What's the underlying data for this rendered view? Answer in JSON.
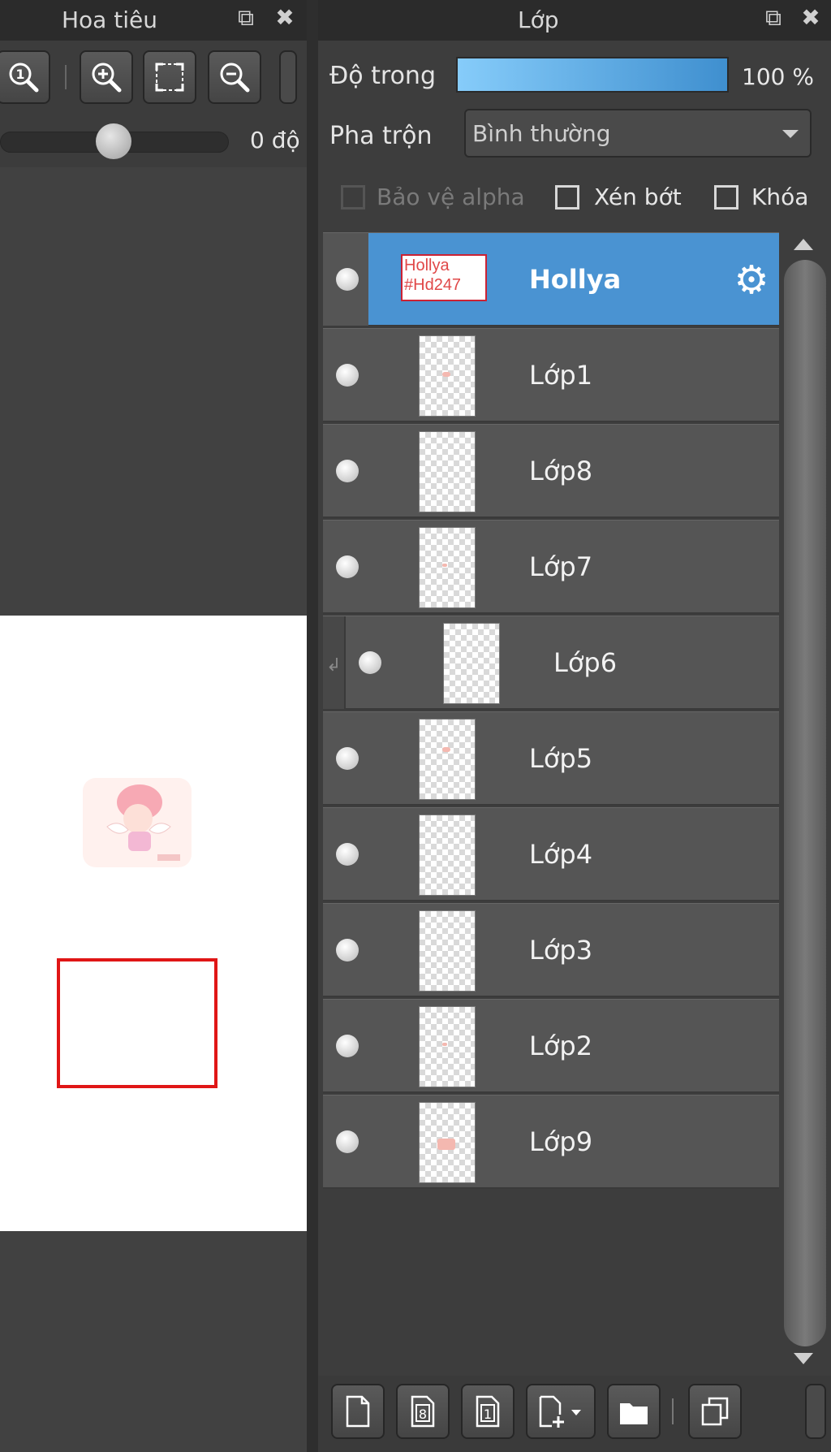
{
  "navigator": {
    "title": "Hoa tiêu",
    "rotation": {
      "value_label": "0 độ",
      "value": 0
    }
  },
  "layers_panel": {
    "title": "Lớp",
    "opacity": {
      "label": "Độ trong",
      "value_label": "100 %",
      "value": 100
    },
    "blend": {
      "label": "Pha trộn",
      "value": "Bình thường"
    },
    "checkboxes": [
      {
        "label": "Bảo vệ alpha",
        "checked": false,
        "enabled": false
      },
      {
        "label": "Xén bớt",
        "checked": false,
        "enabled": true
      },
      {
        "label": "Khóa",
        "checked": false,
        "enabled": true
      }
    ],
    "layers": [
      {
        "name": "Hollya",
        "selected": true,
        "thumbnail_text": "Hollya #Hd247",
        "clipped": false
      },
      {
        "name": "Lớp1",
        "selected": false,
        "clipped": false
      },
      {
        "name": "Lớp8",
        "selected": false,
        "clipped": false
      },
      {
        "name": "Lớp7",
        "selected": false,
        "clipped": false
      },
      {
        "name": "Lớp6",
        "selected": false,
        "clipped": true
      },
      {
        "name": "Lớp5",
        "selected": false,
        "clipped": false
      },
      {
        "name": "Lớp4",
        "selected": false,
        "clipped": false
      },
      {
        "name": "Lớp3",
        "selected": false,
        "clipped": false
      },
      {
        "name": "Lớp2",
        "selected": false,
        "clipped": false
      },
      {
        "name": "Lớp9",
        "selected": false,
        "clipped": false
      }
    ],
    "selected_color": "#4a93d2",
    "bottom_buttons": [
      "new-layer-icon",
      "new-8bit-layer-icon",
      "new-1bit-layer-icon",
      "add-layer-menu-icon",
      "new-folder-icon",
      "duplicate-layer-icon"
    ]
  },
  "colors": {
    "panel_bg": "#3d3d3d",
    "titlebar_bg": "#2b2b2b",
    "selection_rect": "#e01616"
  }
}
